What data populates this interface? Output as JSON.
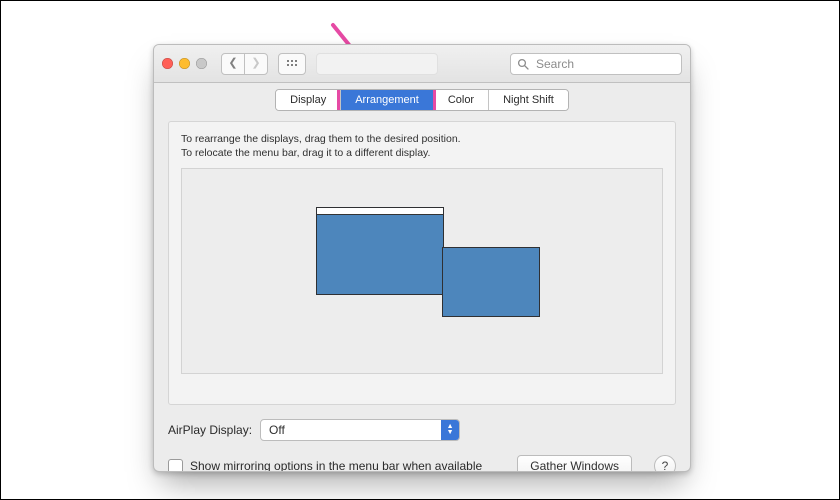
{
  "toolbar": {
    "search_placeholder": "Search"
  },
  "tabs": [
    {
      "label": "Display"
    },
    {
      "label": "Arrangement"
    },
    {
      "label": "Color"
    },
    {
      "label": "Night Shift"
    }
  ],
  "selected_tab_index": 1,
  "instructions": {
    "line1": "To rearrange the displays, drag them to the desired position.",
    "line2": "To relocate the menu bar, drag it to a different display."
  },
  "airplay": {
    "label": "AirPlay Display:",
    "value": "Off"
  },
  "mirroring": {
    "label": "Show mirroring options in the menu bar when available",
    "checked": false
  },
  "buttons": {
    "gather": "Gather Windows",
    "help": "?"
  },
  "colors": {
    "display_fill": "#4d86bc",
    "accent": "#3a77d8",
    "highlight": "#e64aa4"
  }
}
